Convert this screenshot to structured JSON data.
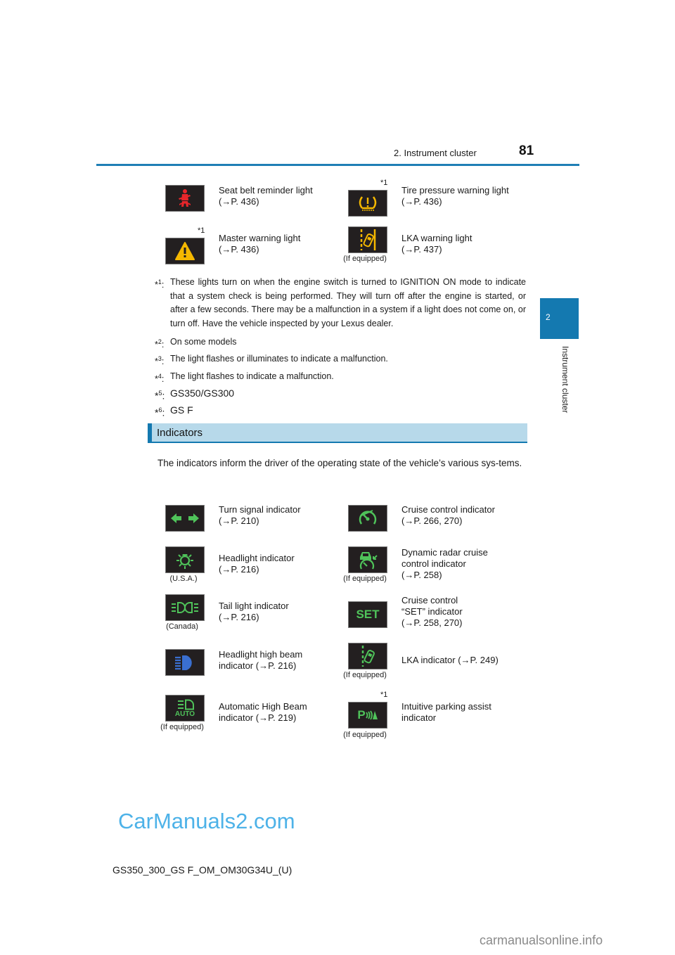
{
  "header": {
    "section_title": "2. Instrument cluster",
    "page_number": "81"
  },
  "side_tab": {
    "chapter_number": "2",
    "chapter_label": "Instrument cluster"
  },
  "warning_lights": [
    {
      "icon": "seat-belt-icon",
      "color": "#e8262b",
      "label": "Seat belt reminder light",
      "ref": "(→P. 436)",
      "footnote": "",
      "caption": ""
    },
    {
      "icon": "tire-pressure-icon",
      "color": "#f5b800",
      "label": "Tire pressure warning light",
      "ref": "(→P. 436)",
      "footnote": "*1",
      "caption": ""
    },
    {
      "icon": "master-warning-icon",
      "color": "#f5b800",
      "label": "Master warning light",
      "ref": "(→P. 436)",
      "footnote": "*1",
      "caption": ""
    },
    {
      "icon": "lka-warning-icon",
      "color": "#f5b800",
      "label": "LKA warning light",
      "ref": "(→P. 437)",
      "footnote": "",
      "caption": "(If equipped)"
    }
  ],
  "footnotes": [
    {
      "mark": "*",
      "num": "1",
      "text": "These lights turn on when the engine switch is turned to IGNITION ON mode to indicate that a system check is being performed. They will turn off after the engine is started, or after a few seconds. There may be a malfunction in a system if a light does not come on, or turn off. Have the vehicle inspected by your Lexus dealer."
    },
    {
      "mark": "*",
      "num": "2",
      "text": "On some models"
    },
    {
      "mark": "*",
      "num": "3",
      "text": "The light flashes or illuminates to indicate a malfunction."
    },
    {
      "mark": "*",
      "num": "4",
      "text": "The light flashes to indicate a malfunction."
    },
    {
      "mark": "*",
      "num": "5",
      "text": "GS350/GS300"
    },
    {
      "mark": "*",
      "num": "6",
      "text": "GS F"
    }
  ],
  "indicators_section": {
    "title": "Indicators",
    "intro": "The indicators inform the driver of the operating state of the vehicle’s various sys-tems."
  },
  "indicators": [
    {
      "icon": "turn-signal-icon",
      "color": "#4fc35a",
      "label_lines": [
        "Turn signal indicator",
        "(→P. 210)"
      ],
      "caption": "",
      "footnote": ""
    },
    {
      "icon": "cruise-control-icon",
      "color": "#4fc35a",
      "label_lines": [
        "Cruise control indicator",
        "(→P. 266, 270)"
      ],
      "caption": "",
      "footnote": ""
    },
    {
      "icon": "headlight-icon",
      "color": "#4fc35a",
      "label_lines": [
        "Headlight indicator",
        "(→P. 216)"
      ],
      "caption": "(U.S.A.)",
      "footnote": ""
    },
    {
      "icon": "dynamic-radar-cruise-icon",
      "color": "#4fc35a",
      "label_lines": [
        "Dynamic radar cruise",
        "control indicator",
        "(→P. 258)"
      ],
      "caption": "(If equipped)",
      "footnote": ""
    },
    {
      "icon": "tail-light-icon",
      "color": "#4fc35a",
      "label_lines": [
        "Tail light indicator",
        "(→P. 216)"
      ],
      "caption": "(Canada)",
      "footnote": ""
    },
    {
      "icon": "cruise-set-icon",
      "color": "#4fc35a",
      "icon_text": "SET",
      "label_lines": [
        "Cruise control",
        "“SET” indicator",
        "(→P. 258, 270)"
      ],
      "caption": "",
      "footnote": ""
    },
    {
      "icon": "high-beam-icon",
      "color": "#3a6fd0",
      "label_lines": [
        "Headlight high beam",
        "indicator (→P. 216)"
      ],
      "caption": "",
      "footnote": ""
    },
    {
      "icon": "lka-indicator-icon",
      "color": "#4fc35a",
      "label_lines": [
        "LKA indicator (→P. 249)"
      ],
      "caption": "(If equipped)",
      "footnote": ""
    },
    {
      "icon": "auto-high-beam-icon",
      "color": "#4fc35a",
      "icon_text": "AUTO",
      "label_lines": [
        "Automatic High Beam",
        "indicator (→P. 219)"
      ],
      "caption": "(If equipped)",
      "footnote": ""
    },
    {
      "icon": "parking-assist-icon",
      "color": "#4fc35a",
      "icon_text": "P",
      "label_lines": [
        "Intuitive parking assist",
        "indicator"
      ],
      "caption": "(If equipped)",
      "footnote": "*1"
    }
  ],
  "watermark": "CarManuals2.com",
  "footer": {
    "doc_code": "GS350_300_GS F_OM_OM30G34U_(U)",
    "site": "carmanualsonline.info"
  }
}
